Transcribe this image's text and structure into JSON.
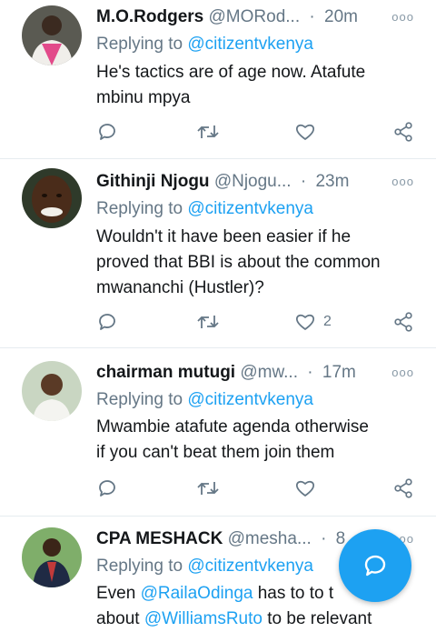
{
  "colors": {
    "accent": "#1da1f2",
    "secondary_text": "#657786",
    "divider": "#e6ecf0"
  },
  "tweets": [
    {
      "name": "M.O.Rodgers",
      "handle": "@MORod...",
      "time": "20m",
      "replying_label": "Replying to",
      "replying_to": "@citizentvkenya",
      "text_lines": [
        "He's tactics are of age now.  Atafute",
        "mbinu mpya"
      ],
      "like_count": ""
    },
    {
      "name": "Githinji Njogu",
      "handle": "@Njogu...",
      "time": "23m",
      "replying_label": "Replying to",
      "replying_to": "@citizentvkenya",
      "text_lines": [
        "Wouldn't it have been easier if he",
        "proved that BBI is about the common",
        "mwananchi (Hustler)?"
      ],
      "like_count": "2"
    },
    {
      "name": "chairman mutugi",
      "handle": "@mw...",
      "time": "17m",
      "replying_label": "Replying to",
      "replying_to": "@citizentvkenya",
      "text_lines": [
        "Mwambie atafute agenda otherwise",
        "if you can't beat them join them"
      ],
      "like_count": ""
    },
    {
      "name": "CPA MESHACK",
      "handle": "@mesha...",
      "time": "8",
      "replying_label": "Replying to",
      "replying_to": "@citizentvkenya",
      "text_line1": {
        "pre": "Even ",
        "mention": "@RailaOdinga",
        "post": " has to to t"
      },
      "text_line2": {
        "pre": "about ",
        "mention": "@WilliamsRuto",
        "post": " to be relevant"
      }
    }
  ],
  "icons": {
    "more": "more-dots-icon",
    "reply": "reply-icon",
    "retweet": "retweet-icon",
    "like": "heart-icon",
    "share": "share-icon",
    "compose": "compose-reply-fab-icon"
  }
}
